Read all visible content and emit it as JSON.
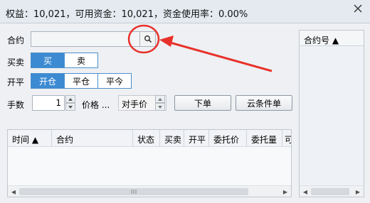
{
  "window": {
    "status_line": "权益：10,021，可用资金：10,021，资金使用率：0.00%"
  },
  "form": {
    "contract_label": "合约",
    "contract_value": "",
    "buysell_label": "买卖",
    "buysell_options": [
      "买",
      "卖"
    ],
    "buysell_selected": "买",
    "openclose_label": "开平",
    "openclose_options": [
      "开仓",
      "平仓",
      "平今"
    ],
    "openclose_selected": "开仓",
    "qty_label": "手数",
    "qty_value": "1",
    "price_label": "价格 ...",
    "price_mode": "对手价",
    "submit_label": "下单",
    "cloud_order_label": "云条件单"
  },
  "orders_table": {
    "columns": [
      "时间 ▲",
      "合约",
      "状态",
      "买卖",
      "开平",
      "委托价",
      "委托量",
      "可"
    ],
    "rows": []
  },
  "contract_list": {
    "header": "合约号 ▲",
    "items": []
  },
  "icons": {
    "search": "search-icon",
    "close": "close-icon"
  },
  "colors": {
    "accent": "#3c8ad2",
    "annotation": "#e8312a"
  }
}
